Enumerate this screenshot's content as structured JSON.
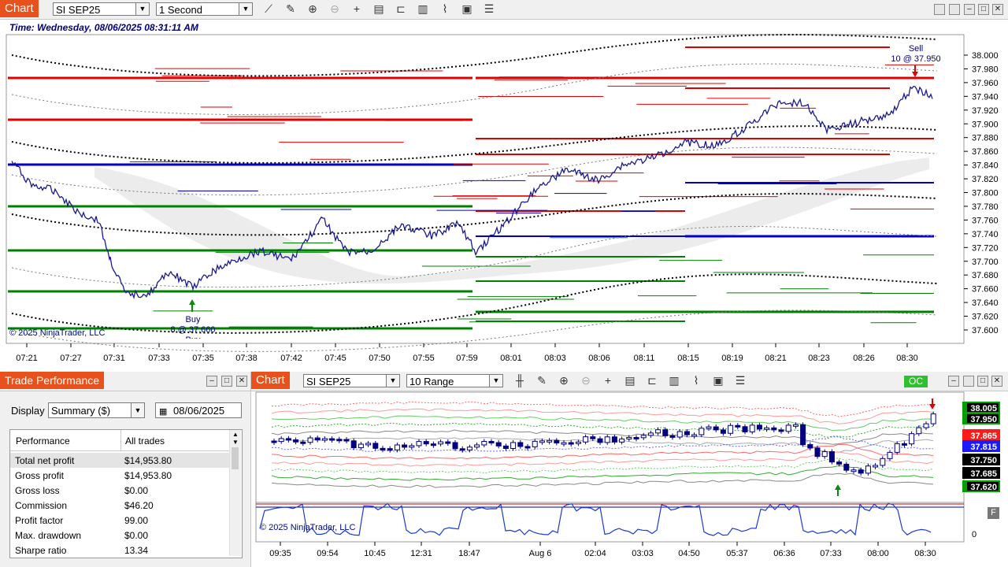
{
  "top_chart": {
    "tab_label": "Chart",
    "instrument": "SI SEP25",
    "interval": "1 Second",
    "time_label": "Time: Wednesday, 08/06/2025 08:31:11 AM",
    "copyright": "© 2025 NinjaTrader, LLC",
    "sell_marker": {
      "label": "Sell",
      "detail": "10 @ 37.950"
    },
    "buy_marker": {
      "label": "Buy",
      "detail": "8 @ 37.660",
      "extra": "Buy"
    },
    "price_ticks": [
      "38.000",
      "37.980",
      "37.960",
      "37.940",
      "37.920",
      "37.900",
      "37.880",
      "37.860",
      "37.840",
      "37.820",
      "37.800",
      "37.780",
      "37.760",
      "37.740",
      "37.720",
      "37.700",
      "37.680",
      "37.660",
      "37.640",
      "37.620",
      "37.600"
    ],
    "time_ticks": [
      "07:21",
      "07:27",
      "07:31",
      "07:33",
      "07:35",
      "07:38",
      "07:42",
      "07:45",
      "07:50",
      "07:55",
      "07:59",
      "08:01",
      "08:03",
      "08:06",
      "08:11",
      "08:15",
      "08:19",
      "08:21",
      "08:23",
      "08:26",
      "08:30"
    ]
  },
  "trade_perf": {
    "title": "Trade Performance",
    "display_label": "Display",
    "display_value": "Summary ($)",
    "date_value": "08/06/2025",
    "col_perf": "Performance",
    "col_all": "All trades",
    "rows": [
      {
        "label": "Total net profit",
        "value": "$14,953.80"
      },
      {
        "label": "Gross profit",
        "value": "$14,953.80"
      },
      {
        "label": "Gross loss",
        "value": "$0.00"
      },
      {
        "label": "Commission",
        "value": "$46.20"
      },
      {
        "label": "Profit factor",
        "value": "99.00"
      },
      {
        "label": "Max. drawdown",
        "value": "$0.00"
      },
      {
        "label": "Sharpe ratio",
        "value": "13.34"
      }
    ]
  },
  "bottom_chart": {
    "tab_label": "Chart",
    "instrument": "SI SEP25",
    "interval": "10 Range",
    "oc_label": "OC",
    "copyright": "© 2025 NinjaTrader, LLC",
    "f_label": "F",
    "indicator_zero": "0",
    "price_tags": [
      {
        "value": "38.005",
        "color": "#000000",
        "outline": "#00a000"
      },
      {
        "value": "37.950",
        "color": "#000000",
        "outline": "#00a000"
      },
      {
        "value": "37.865",
        "color": "#ff1a1a",
        "outline": "#ff1a1a"
      },
      {
        "value": "37.815",
        "color": "#1a1aff",
        "outline": "#1a1aff"
      },
      {
        "value": "37.750",
        "color": "#000000",
        "outline": "#000000"
      },
      {
        "value": "37.685",
        "color": "#000000",
        "outline": "#000000"
      },
      {
        "value": "37.620",
        "color": "#000000",
        "outline": "#00a000"
      }
    ],
    "time_ticks": [
      "09:35",
      "09:54",
      "10:45",
      "12:31",
      "18:47",
      "Aug 6",
      "02:04",
      "03:03",
      "04:50",
      "05:37",
      "06:36",
      "07:33",
      "08:00",
      "08:30"
    ]
  }
}
